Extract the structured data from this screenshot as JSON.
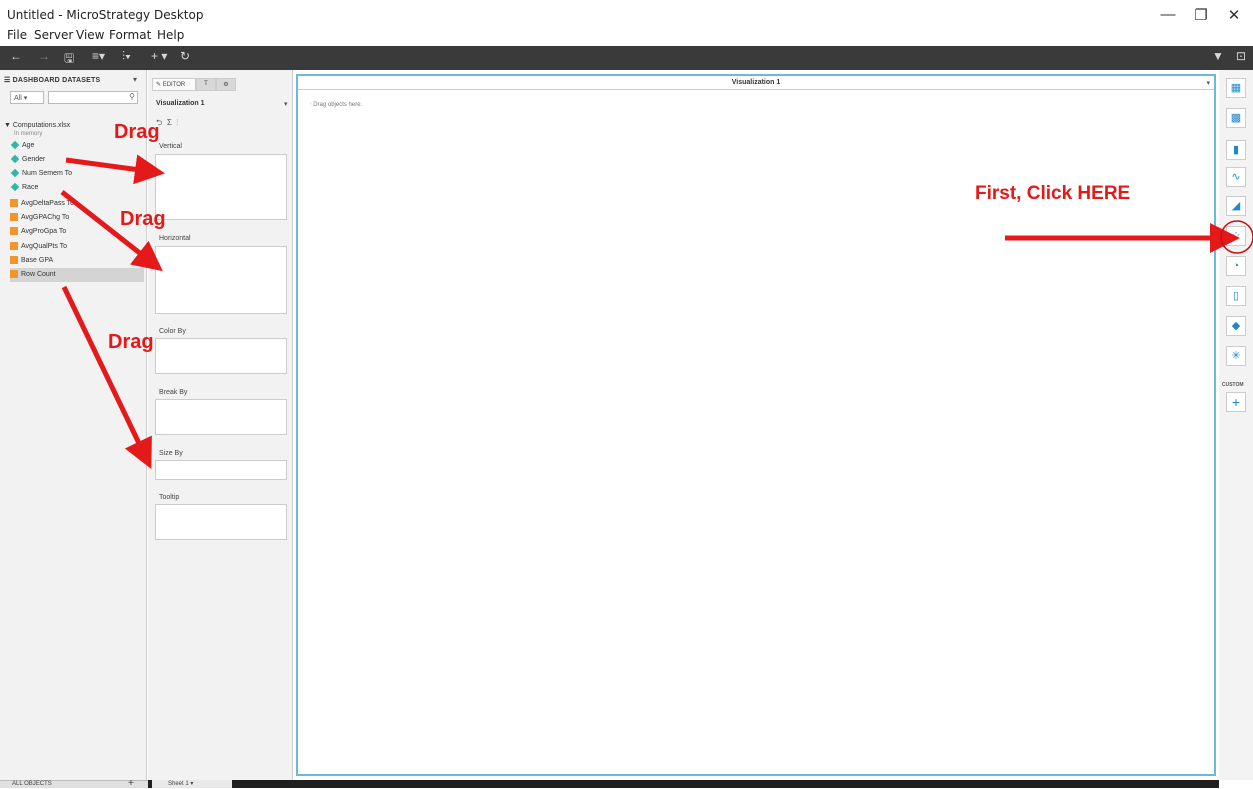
{
  "window": {
    "title": "Untitled - MicroStrategy Desktop",
    "controls": [
      "—",
      "❐",
      "✕"
    ]
  },
  "menu": [
    "File",
    "Server",
    "View",
    "Format",
    "Help"
  ],
  "toolbar": {
    "left_icons": [
      "back-icon",
      "forward-icon",
      "save-icon",
      "add-data-icon",
      "insert-viz-icon",
      "add-icon",
      "refresh-icon"
    ],
    "left_glyphs": [
      "←",
      "→",
      "🖫",
      "≡▾",
      "⫶▾",
      "+ ▾",
      "↻"
    ],
    "right_glyphs": [
      "▼",
      "⊡"
    ]
  },
  "datasets": {
    "header": "DASHBOARD DATASETS",
    "filter_value": "All",
    "search_placeholder": "",
    "dataset_name": "▼ Computations.xlsx",
    "dataset_sub": "In memory",
    "fields": [
      {
        "label": "Age",
        "kind": "attribute"
      },
      {
        "label": "Gender",
        "kind": "attribute"
      },
      {
        "label": "Num Semem To",
        "kind": "attribute"
      },
      {
        "label": "Race",
        "kind": "attribute"
      },
      {
        "label": "AvgDeltaPass To",
        "kind": "metric"
      },
      {
        "label": "AvgGPAChg To",
        "kind": "metric"
      },
      {
        "label": "AvgProGpa To",
        "kind": "metric"
      },
      {
        "label": "AvgQualPts To",
        "kind": "metric"
      },
      {
        "label": "Base GPA",
        "kind": "metric"
      },
      {
        "label": "Row Count",
        "kind": "metric"
      }
    ],
    "bottom_label": "ALL OBJECTS"
  },
  "editor": {
    "tabs": [
      "EDITOR",
      "T",
      "⚙"
    ],
    "viz_selected": "Visualization 1",
    "drop_zones": [
      "Vertical",
      "Horizontal",
      "Color By",
      "Break By",
      "Size By",
      "Tooltip"
    ]
  },
  "canvas": {
    "title": "Visualization 1",
    "hint": "Drag objects here."
  },
  "gallery": {
    "icons": [
      "grid-icon",
      "heatmap-icon",
      "bar-chart-icon",
      "line-chart-icon",
      "area-chart-icon",
      "bubble-chart-icon",
      "pie-chart-icon",
      "combo-chart-icon",
      "map-icon",
      "network-icon"
    ],
    "glyphs": [
      "▦",
      "▩",
      "▮",
      "∿",
      "◢",
      "⁘",
      "◔",
      "▯",
      "◆",
      "✳"
    ],
    "custom_label": "CUSTOM",
    "add_glyph": "+"
  },
  "sheet": {
    "tab_label": "Sheet 1 ▾"
  },
  "annotations": {
    "drag1": "Drag",
    "drag2": "Drag",
    "drag3": "Drag",
    "click_here": "First, Click HERE",
    "color": "#e3191a"
  }
}
